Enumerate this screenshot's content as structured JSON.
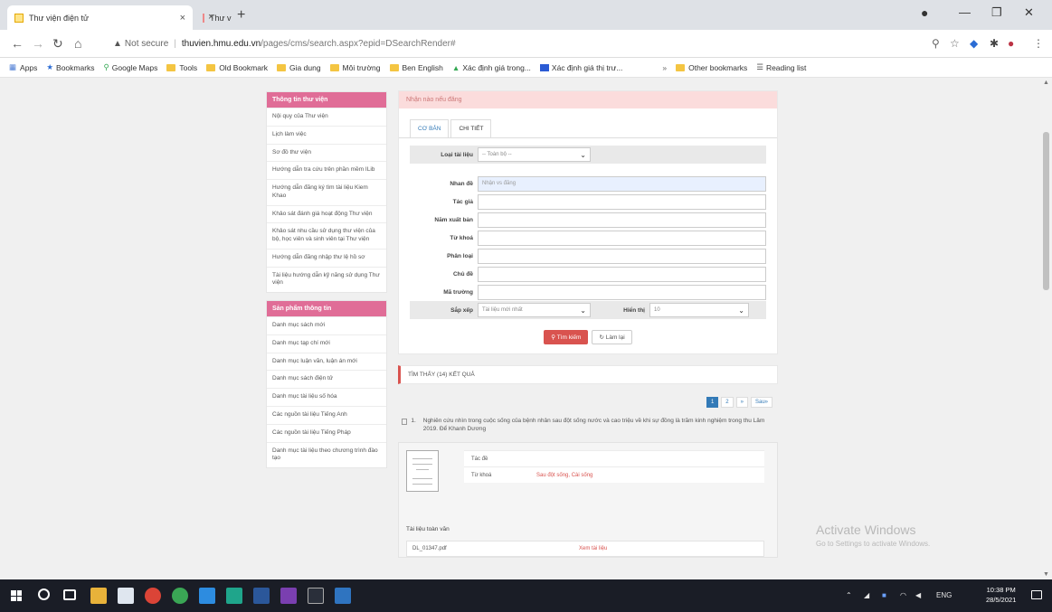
{
  "browser": {
    "tabs": [
      {
        "title": "Thư viện điện tử"
      },
      {
        "title": "Thư viện Đại Học Y"
      }
    ],
    "address": {
      "security": "Not secure",
      "host": "thuvien.hmu.edu.vn",
      "path": "/pages/cms/search.aspx?epid=DSearchRender#"
    },
    "bookmarks": [
      "Apps",
      "Bookmarks",
      "Google Maps",
      "Tools",
      "Old Bookmark",
      "Gia dung",
      "Môi trường",
      "Ben English",
      "Xác định giá trong...",
      "Xác định giá thị trư...",
      "Other bookmarks",
      "Reading list"
    ]
  },
  "sidebar": {
    "box1": {
      "title": "Thông tin thư viện",
      "items": [
        "Nội quy của Thư viện",
        "Lịch làm việc",
        "Sơ đồ thư viện",
        "Hướng dẫn tra cứu trên phần mềm ILib",
        "Hướng dẫn đăng ký tìm tài liệu Kiem Khao",
        "Khảo sát đánh giá hoạt động Thư viện",
        "Khảo sát nhu cầu sử dụng thư viện của bộ, học viên và sinh viên tại Thư viện",
        "Hướng dẫn đăng nhập thư lệ hồ sơ",
        "Tài liệu hướng dẫn kỹ năng sử dụng Thư viện"
      ]
    },
    "box2": {
      "title": "Sản phẩm thông tin",
      "items": [
        "Danh mục sách mới",
        "Danh mục tạp chí mới",
        "Danh mục luận văn, luận án mới",
        "Danh mục sách điện tử",
        "Danh mục tài liệu số hóa",
        "Các nguồn tài liệu Tiếng Anh",
        "Các nguồn tài liệu Tiếng Pháp",
        "Danh mục tài liệu theo chương trình đào tạo"
      ]
    }
  },
  "search": {
    "header": "Nhận nào nếu đăng",
    "tabs": [
      "CƠ BẢN",
      "CHI TIẾT"
    ],
    "fields": {
      "type_label": "Loại tài liệu",
      "type_value": "-- Toàn bộ --",
      "title_label": "Nhan đề",
      "title_value": "Nhận vs đăng",
      "author_label": "Tác giả",
      "publisher_label": "Năm xuất bản",
      "keyword_label": "Từ khoá",
      "subject_label": "Phân loại",
      "topic_label": "Chủ đề",
      "code_label": "Mã trường",
      "sort_label": "Sắp xếp",
      "sort_value": "Tài liệu mới nhất",
      "perpage_label": "Hiển thị",
      "perpage_value": "10"
    },
    "buttons": {
      "search": "Tìm kiếm",
      "reset": "Làm lại"
    }
  },
  "results": {
    "header": "TÌM THẤY (14) KẾT QUẢ",
    "pager": [
      "1",
      "2",
      "»",
      "Sau»"
    ],
    "item": {
      "num": "1.",
      "title": "Nghiên cứu nhìn trong cuộc sống của bệnh nhân sau đột sống nước và cao triệu về khi sự đồng là trăm kinh nghiệm trong thu Lâm 2019. Để Khanh Dương",
      "meta": [
        {
          "k": "Tác đề",
          "v": ""
        },
        {
          "k": "Từ khoá",
          "v": "Sau đột sống, Cài sống"
        }
      ],
      "attach_label": "Tài liệu toàn văn",
      "attach_file": "DL_01347.pdf",
      "attach_link": "Xem tài liệu"
    }
  },
  "watermark": {
    "line1": "Activate Windows",
    "line2": "Go to Settings to activate Windows."
  },
  "taskbar": {
    "time": "10:38 PM",
    "date": "28/5/2021",
    "lang": "ENG"
  }
}
